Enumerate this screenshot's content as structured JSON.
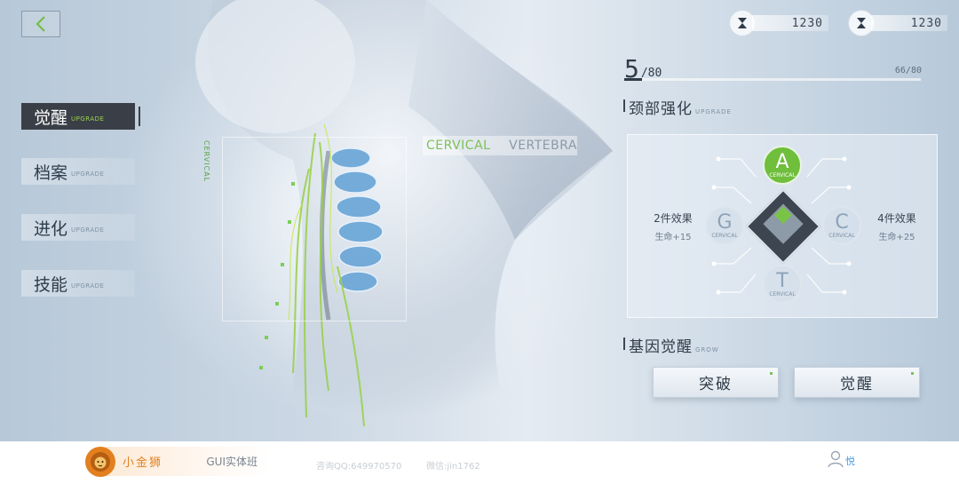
{
  "currencies": [
    {
      "icon": "hourglass-icon",
      "value": "1230"
    },
    {
      "icon": "hourglass-icon",
      "value": "1230"
    }
  ],
  "menu": [
    {
      "label": "觉醒",
      "sub": "UPGRADE",
      "active": true
    },
    {
      "label": "档案",
      "sub": "UPGRADE",
      "active": false
    },
    {
      "label": "进化",
      "sub": "UPGRADE",
      "active": false
    },
    {
      "label": "技能",
      "sub": "UPGRADE",
      "active": false
    }
  ],
  "scan": {
    "label_left": "CERVICAL",
    "label_right": "VERTEBRA",
    "vertical_label": "CERVICAL"
  },
  "level": {
    "current": "5",
    "max_text": "/80",
    "right_text": "66/80",
    "progress": 0.06
  },
  "section_neck": {
    "title": "颈部强化",
    "en": "UPGRADE"
  },
  "slots": {
    "top": {
      "letter": "A",
      "tag": "CERVICAL"
    },
    "left": {
      "letter": "G",
      "tag": "CERVICAL"
    },
    "right": {
      "letter": "C",
      "tag": "CERVICAL"
    },
    "bottom": {
      "letter": "T",
      "tag": "CERVICAL"
    }
  },
  "effects": {
    "left": {
      "title": "2件效果",
      "bonus": "生命+15"
    },
    "right": {
      "title": "4件效果",
      "bonus": "生命+25"
    }
  },
  "section_gene": {
    "title": "基因觉醒",
    "en": "GROW"
  },
  "buttons": {
    "breakthrough": "突破",
    "awaken": "觉醒"
  },
  "footer": {
    "brand": "小金狮",
    "course": "GUI实体班",
    "qq": "咨询QQ:649970570",
    "wechat": "微信:jin1762",
    "user": "悦"
  },
  "colors": {
    "accent_green": "#6fbe3c",
    "dark": "#3a3f47",
    "brand_orange": "#e2801f"
  }
}
